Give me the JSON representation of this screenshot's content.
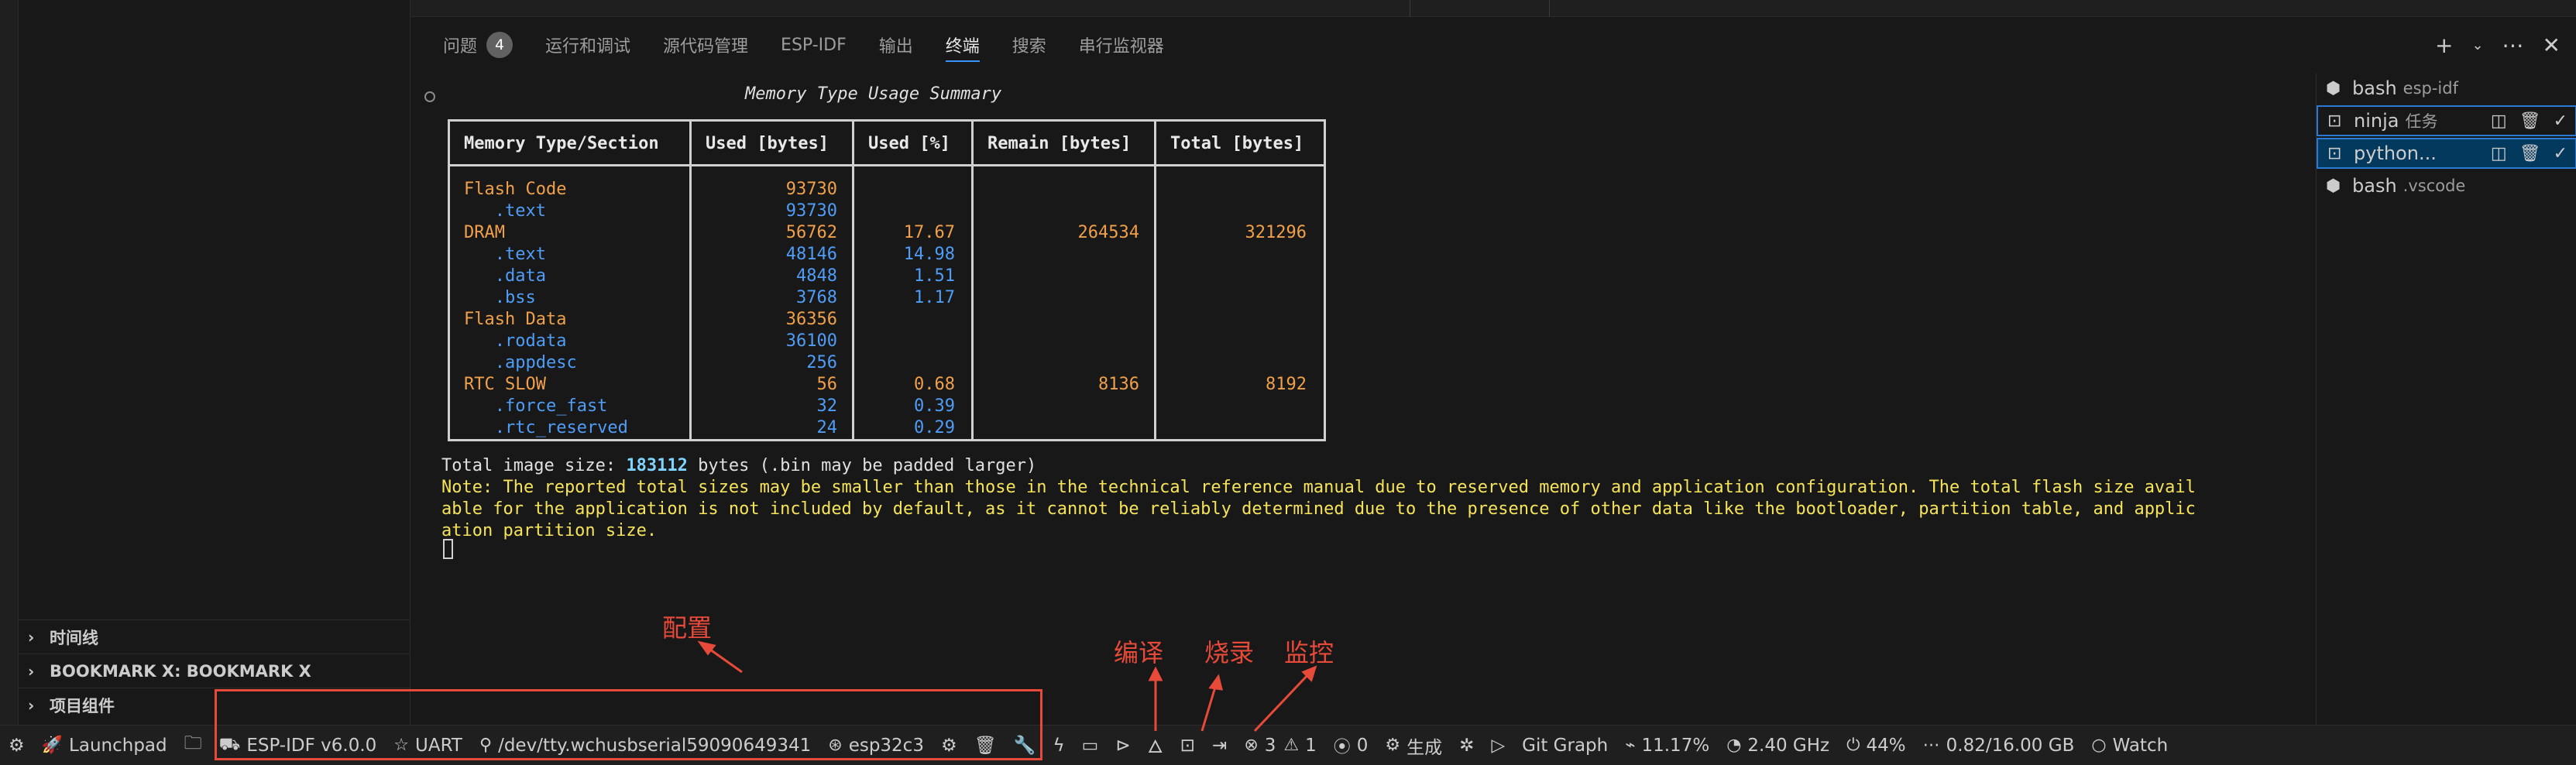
{
  "sidebar": {
    "sections": [
      {
        "label": "时间线"
      },
      {
        "label": "BOOKMARK X: BOOKMARK X"
      },
      {
        "label": "项目组件"
      }
    ]
  },
  "panel": {
    "tabs": [
      {
        "label": "问题",
        "badge": "4"
      },
      {
        "label": "运行和调试"
      },
      {
        "label": "源代码管理"
      },
      {
        "label": "ESP-IDF"
      },
      {
        "label": "输出"
      },
      {
        "label": "终端",
        "active": true
      },
      {
        "label": "搜索"
      },
      {
        "label": "串行监视器"
      }
    ]
  },
  "terminal": {
    "title": "Memory Type Usage Summary",
    "table": {
      "headers": [
        "Memory Type/Section",
        "Used [bytes]",
        "Used [%]",
        "Remain [bytes]",
        "Total [bytes]"
      ],
      "rows": [
        {
          "name": "Flash Code",
          "used": "93730",
          "pct": "",
          "remain": "",
          "total": "",
          "kind": "group"
        },
        {
          "name": "   .text",
          "used": "93730",
          "pct": "",
          "remain": "",
          "total": "",
          "kind": "sub"
        },
        {
          "name": "DRAM",
          "used": "56762",
          "pct": "17.67",
          "remain": "264534",
          "total": "321296",
          "kind": "group"
        },
        {
          "name": "   .text",
          "used": "48146",
          "pct": "14.98",
          "remain": "",
          "total": "",
          "kind": "sub"
        },
        {
          "name": "   .data",
          "used": "4848",
          "pct": "1.51",
          "remain": "",
          "total": "",
          "kind": "sub"
        },
        {
          "name": "   .bss",
          "used": "3768",
          "pct": "1.17",
          "remain": "",
          "total": "",
          "kind": "sub"
        },
        {
          "name": "Flash Data",
          "used": "36356",
          "pct": "",
          "remain": "",
          "total": "",
          "kind": "group"
        },
        {
          "name": "   .rodata",
          "used": "36100",
          "pct": "",
          "remain": "",
          "total": "",
          "kind": "sub"
        },
        {
          "name": "   .appdesc",
          "used": "256",
          "pct": "",
          "remain": "",
          "total": "",
          "kind": "sub"
        },
        {
          "name": "RTC SLOW",
          "used": "56",
          "pct": "0.68",
          "remain": "8136",
          "total": "8192",
          "kind": "group"
        },
        {
          "name": "   .force_fast",
          "used": "32",
          "pct": "0.39",
          "remain": "",
          "total": "",
          "kind": "sub"
        },
        {
          "name": "   .rtc_reserved",
          "used": "24",
          "pct": "0.29",
          "remain": "",
          "total": "",
          "kind": "sub"
        }
      ]
    },
    "total_prefix": "Total image size: ",
    "total_value": "183112",
    "total_suffix": " bytes (.bin may be padded larger)",
    "note_lines": [
      "Note: The reported total sizes may be smaller than those in the technical reference manual due to reserved memory and application configuration. The total flash size avail",
      "able for the application is not included by default, as it cannot be reliably determined due to the presence of other data like the bootloader, partition table, and applic",
      "ation partition size."
    ]
  },
  "terminal_list": [
    {
      "name": "bash",
      "sub": "esp-idf"
    },
    {
      "name": "ninja",
      "sub": "任务"
    },
    {
      "name": "python...",
      "sub": ""
    },
    {
      "name": "bash",
      "sub": ".vscode"
    }
  ],
  "status_bar": {
    "launchpad": "Launchpad",
    "idf_version": "ESP-IDF v6.0.0",
    "flash_method": "UART",
    "port": "/dev/tty.wchusbserial59090649341",
    "target": "esp32c3",
    "errors": "3",
    "warnings": "1",
    "ports": "0",
    "build": "生成",
    "git_graph": "Git Graph",
    "cpu": "11.17%",
    "freq": "2.40 GHz",
    "battery": "44%",
    "memory": "0.82/16.00 GB",
    "watch": "Watch"
  },
  "annotations": {
    "config": "配置",
    "build": "编译",
    "flash": "烧录",
    "monitor": "监控"
  },
  "colors": {
    "accent": "#3794ff",
    "annotation": "#e84a3a",
    "orange": "#f0a04a",
    "blue": "#4f9df7",
    "yellow": "#f5e35a"
  }
}
